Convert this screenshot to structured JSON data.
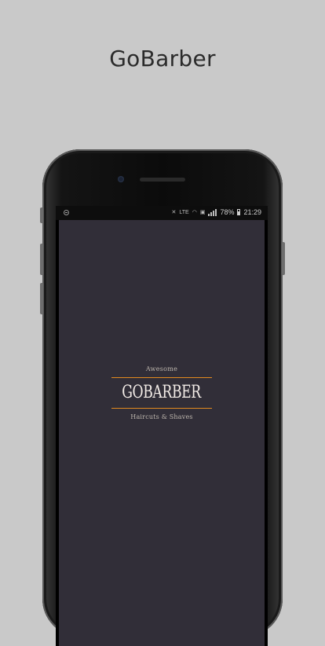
{
  "page": {
    "title": "GoBarber"
  },
  "status_bar": {
    "battery": "78%",
    "time": "21:29",
    "network": "LTE"
  },
  "logo": {
    "top_text": "Awesome",
    "main_text": "GOBARBER",
    "bottom_text": "Haircuts & Shaves",
    "accent_color": "#e28a1e"
  },
  "colors": {
    "background": "#c9c9c9",
    "app_background": "#312e38"
  }
}
